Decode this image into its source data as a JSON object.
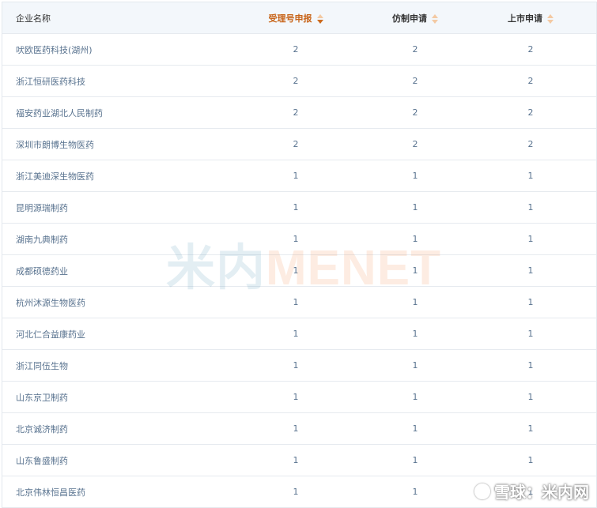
{
  "table": {
    "headers": {
      "company": "企业名称",
      "acceptance": "受理号申报",
      "generic": "仿制申请",
      "listing": "上市申请"
    },
    "rows": [
      {
        "company": "吠欧医药科技(湖州)",
        "acceptance": "2",
        "generic": "2",
        "listing": "2"
      },
      {
        "company": "浙江恒研医药科技",
        "acceptance": "2",
        "generic": "2",
        "listing": "2"
      },
      {
        "company": "福安药业湖北人民制药",
        "acceptance": "2",
        "generic": "2",
        "listing": "2"
      },
      {
        "company": "深圳市朗博生物医药",
        "acceptance": "2",
        "generic": "2",
        "listing": "2"
      },
      {
        "company": "浙江美迪深生物医药",
        "acceptance": "1",
        "generic": "1",
        "listing": "1"
      },
      {
        "company": "昆明源瑞制药",
        "acceptance": "1",
        "generic": "1",
        "listing": "1"
      },
      {
        "company": "湖南九典制药",
        "acceptance": "1",
        "generic": "1",
        "listing": "1"
      },
      {
        "company": "成都硕德药业",
        "acceptance": "1",
        "generic": "1",
        "listing": "1"
      },
      {
        "company": "杭州沐源生物医药",
        "acceptance": "1",
        "generic": "1",
        "listing": "1"
      },
      {
        "company": "河北仁合益康药业",
        "acceptance": "1",
        "generic": "1",
        "listing": "1"
      },
      {
        "company": "浙江同伍生物",
        "acceptance": "1",
        "generic": "1",
        "listing": "1"
      },
      {
        "company": "山东京卫制药",
        "acceptance": "1",
        "generic": "1",
        "listing": "1"
      },
      {
        "company": "北京诚济制药",
        "acceptance": "1",
        "generic": "1",
        "listing": "1"
      },
      {
        "company": "山东鲁盛制药",
        "acceptance": "1",
        "generic": "1",
        "listing": "1"
      },
      {
        "company": "北京伟林恒昌医药",
        "acceptance": "1",
        "generic": "1",
        "listing": "1"
      }
    ]
  },
  "watermark": {
    "cn": "米内",
    "en": "MENET"
  },
  "xueqiu": {
    "text": "雪球：米内网"
  },
  "colors": {
    "active_sort": "#c8651a",
    "header_bg": "#f3f7fb",
    "cell_text": "#59738f"
  }
}
